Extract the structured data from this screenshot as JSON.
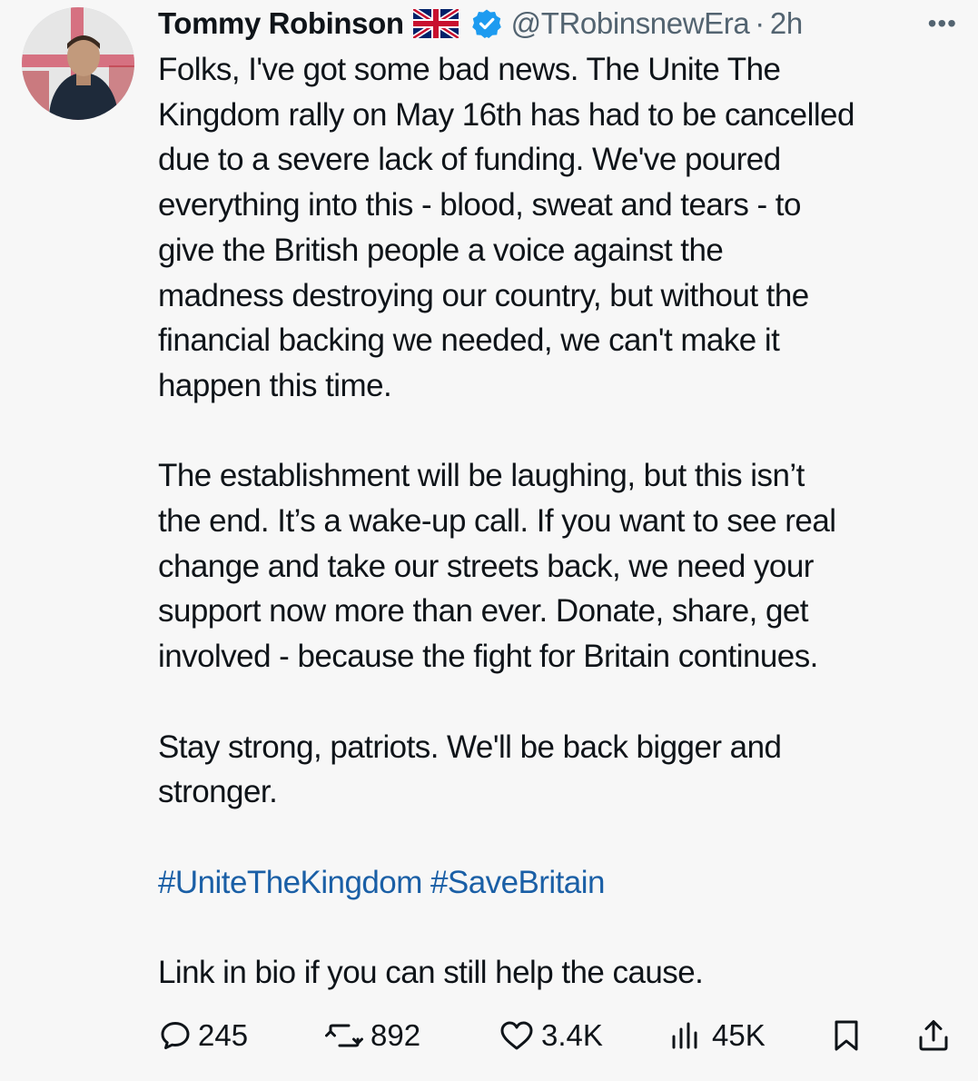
{
  "tweet": {
    "author": {
      "display_name": "Tommy Robinson",
      "handle": "@TRobinsnewEra",
      "separator": "·",
      "time": "2h"
    },
    "paragraphs": [
      "Folks, I've got some bad news. The Unite The\nKingdom rally on May 16th has had to be cancelled\ndue to a severe lack of funding. We've poured\neverything into this - blood, sweat and tears - to\ngive the British people a voice against the\nmadness destroying our country, but without the\nfinancial backing we needed, we can't make it\nhappen this time.",
      "The establishment will be laughing, but this isn’t\nthe end. It’s a wake-up call. If you want to see real\nchange and take our streets back, we need your\nsupport now more than ever. Donate, share, get\ninvolved - because the fight for Britain continues.",
      "Stay strong, patriots. We'll be back bigger and\nstronger."
    ],
    "hashtags": [
      "#UniteTheKingdom",
      "#SaveBritain"
    ],
    "closing": "Link in bio if you can still help the cause.",
    "stats": {
      "replies": "245",
      "reposts": "892",
      "likes": "3.4K",
      "views": "45K"
    }
  },
  "icons": {
    "flag": "uk-flag-icon",
    "verified": "verified-badge-icon",
    "more": "more-icon",
    "reply": "reply-icon",
    "repost": "repost-icon",
    "like": "like-icon",
    "views": "views-icon",
    "bookmark": "bookmark-icon",
    "share": "share-icon"
  },
  "colors": {
    "background": "#f7f7f7",
    "text": "#0f1419",
    "secondary": "#536471",
    "hashtag": "#1a5fa6",
    "verified": "#1d9bf0"
  }
}
